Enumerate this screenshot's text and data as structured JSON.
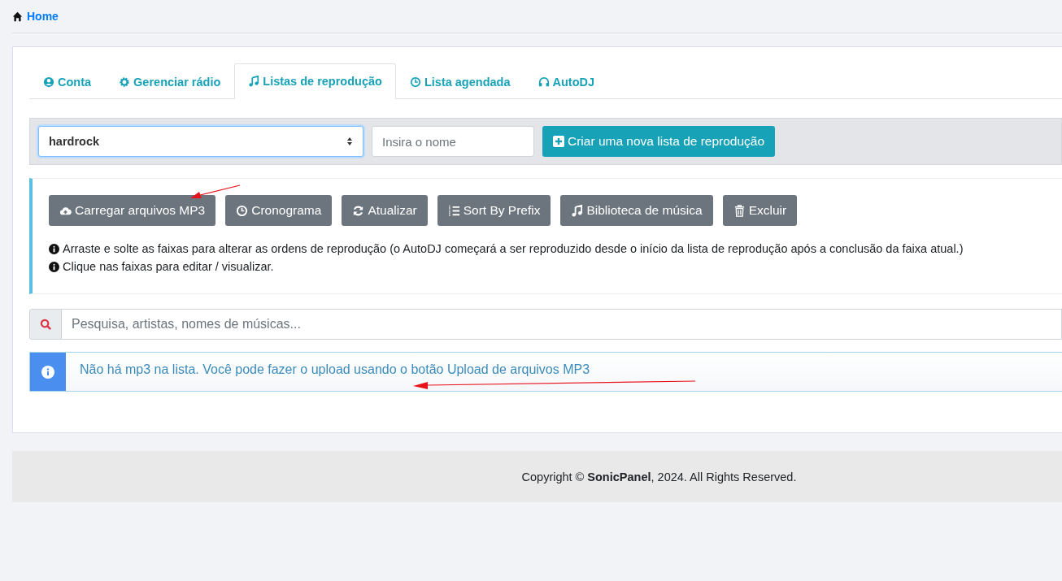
{
  "breadcrumb": {
    "label": "Home"
  },
  "tabs": [
    {
      "label": "Conta",
      "selected": false
    },
    {
      "label": "Gerenciar rádio",
      "selected": false
    },
    {
      "label": "Listas de reprodução",
      "selected": true
    },
    {
      "label": "Lista agendada",
      "selected": false
    },
    {
      "label": "AutoDJ",
      "selected": false
    }
  ],
  "playlist_select": {
    "value": "hardrock"
  },
  "name_field": {
    "placeholder": "Insira o nome"
  },
  "create_button": {
    "label": "Criar uma nova lista de reprodução"
  },
  "actions": [
    {
      "label": "Carregar arquivos MP3"
    },
    {
      "label": "Cronograma"
    },
    {
      "label": "Atualizar"
    },
    {
      "label": "Sort By Prefix"
    },
    {
      "label": "Biblioteca de música"
    },
    {
      "label": "Excluir"
    }
  ],
  "hints": [
    "Arraste e solte as faixas para alterar as ordens de reprodução (o AutoDJ começará a ser reproduzido desde o início da lista de reprodução após a conclusão da faixa atual.)",
    "Clique nas faixas para editar / visualizar."
  ],
  "search": {
    "placeholder": "Pesquisa, artistas, nomes de músicas..."
  },
  "notice": "Não há mp3 na lista. Você pode fazer o upload usando o botão Upload de arquivos MP3",
  "footer": "Copyright © **SonicPanel**, 2024. All Rights Reserved."
}
